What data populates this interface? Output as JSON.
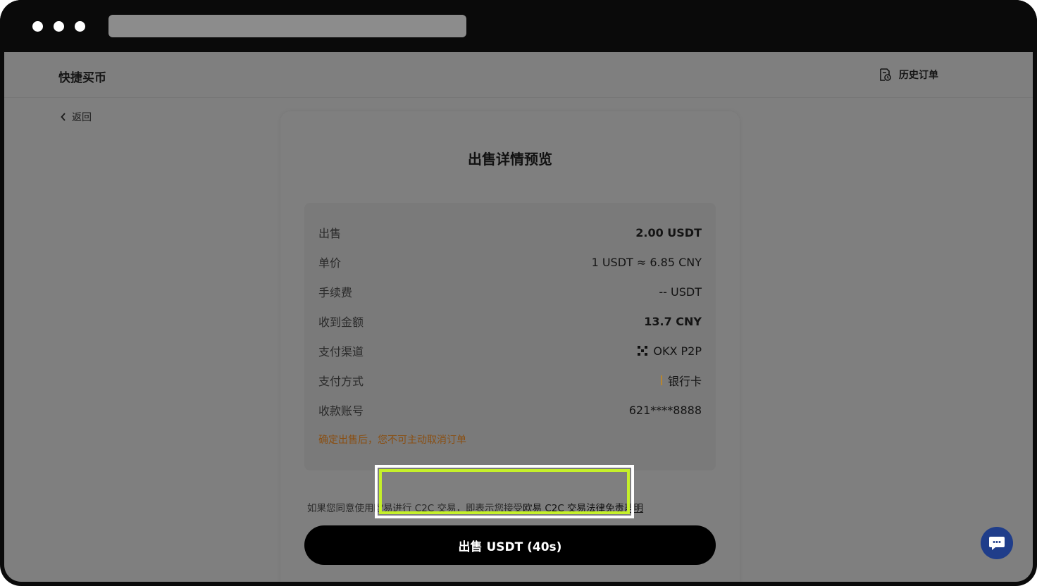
{
  "nav": {
    "brand": "快捷买币",
    "history_label": "历史订单",
    "back_label": "返回"
  },
  "card": {
    "title": "出售详情预览",
    "rows": [
      {
        "label": "出售",
        "value": "2.00 USDT"
      },
      {
        "label": "单价",
        "value": "1 USDT ≈ 6.85 CNY"
      },
      {
        "label": "手续费",
        "value": "-- USDT"
      },
      {
        "label": "收到金额",
        "value": "13.7 CNY"
      },
      {
        "label": "支付渠道",
        "value": "OKX P2P"
      },
      {
        "label": "支付方式",
        "value": "银行卡"
      },
      {
        "label": "收款账号",
        "value": "621****8888"
      }
    ],
    "warning": "确定出售后，您不可主动取消订单",
    "agreement_text": "如果您同意使用欧易进行 C2C 交易，即表示您接受",
    "agreement_link": "欧易 C2C 交易法律免责声明",
    "cta_label": "出售 USDT (40s)"
  },
  "colors": {
    "highlight": "#c5f02a",
    "warning": "#8a4f12",
    "chat": "#1f3d8a"
  }
}
